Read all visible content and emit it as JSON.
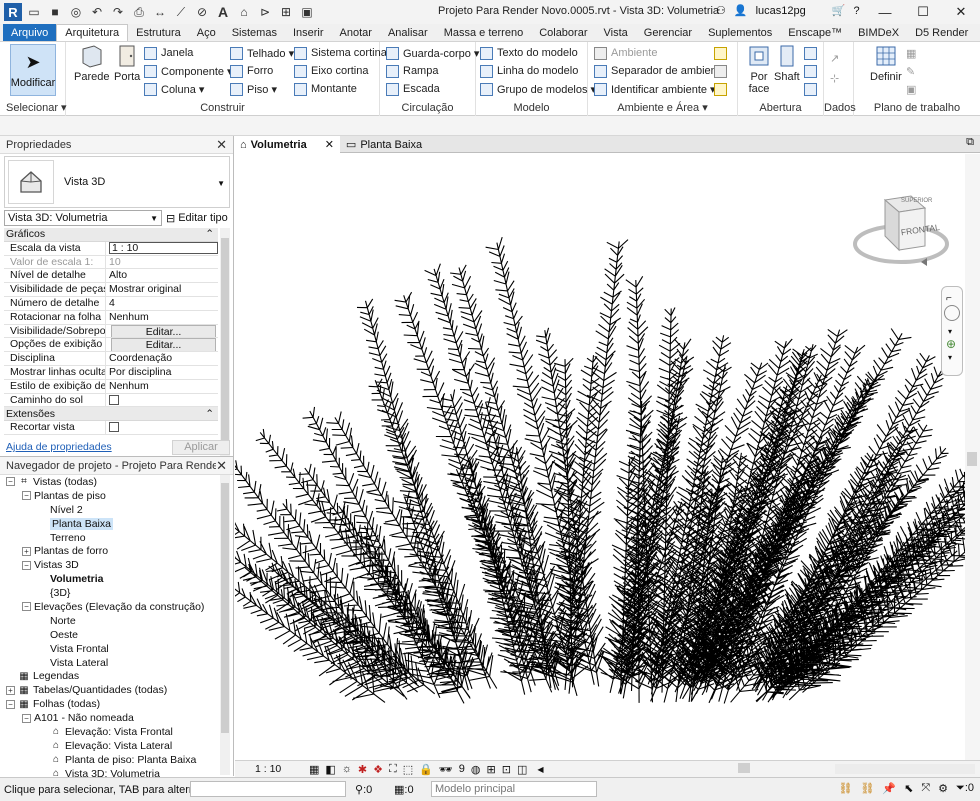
{
  "titlebar": {
    "doc_title": "Projeto Para Render Novo.0005.rvt - Vista 3D: Volumetria",
    "username": "lucas12pg",
    "app_logo_letter": "R",
    "text_tool": "A"
  },
  "tabs": [
    "Arquivo",
    "Arquitetura",
    "Estrutura",
    "Aço",
    "Sistemas",
    "Inserir",
    "Anotar",
    "Analisar",
    "Massa e terreno",
    "Colaborar",
    "Vista",
    "Gerenciar",
    "Suplementos",
    "Enscape™",
    "BIMDeX",
    "D5 Render"
  ],
  "ribbon": {
    "modify": "Modificar",
    "select": "Selecionar ▾",
    "construir": {
      "label": "Construir",
      "parede": "Parede",
      "porta": "Porta",
      "janela": "Janela",
      "componente": "Componente ▾",
      "coluna": "Coluna ▾",
      "telhado": "Telhado ▾",
      "forro": "Forro",
      "piso": "Piso ▾",
      "sistema_cortina": "Sistema cortina",
      "eixo_cortina": "Eixo cortina",
      "montante": "Montante"
    },
    "circulacao": {
      "label": "Circulação",
      "guarda_corpo": "Guarda-corpo ▾",
      "rampa": "Rampa",
      "escada": "Escada"
    },
    "modelo": {
      "label": "Modelo",
      "texto": "Texto do modelo",
      "linha": "Linha do modelo",
      "grupo": "Grupo de modelos ▾"
    },
    "ambiente": {
      "label": "Ambiente e Área ▾",
      "ambiente": "Ambiente",
      "separador": "Separador de ambiente",
      "identificar": "Identificar ambiente ▾"
    },
    "abertura": {
      "label": "Abertura",
      "por_face": "Por face",
      "shaft": "Shaft"
    },
    "dados": {
      "label": "Dados"
    },
    "plano": {
      "label": "Plano de trabalho",
      "definir": "Definir"
    }
  },
  "properties": {
    "title": "Propriedades",
    "type_name": "Vista 3D",
    "view_selector": "Vista 3D: Volumetria",
    "edit_type": "Editar tipo",
    "section_graficos": "Gráficos",
    "section_extensoes": "Extensões",
    "rows": [
      {
        "k": "Escala da vista",
        "v": "1 : 10"
      },
      {
        "k": "Valor de escala    1:",
        "v": "10"
      },
      {
        "k": "Nível de detalhe",
        "v": "Alto"
      },
      {
        "k": "Visibilidade de peças",
        "v": "Mostrar original"
      },
      {
        "k": "Número de detalhe",
        "v": "4"
      },
      {
        "k": "Rotacionar na folha",
        "v": "Nenhum"
      },
      {
        "k": "Visibilidade/Sobrepos...",
        "v": "Editar..."
      },
      {
        "k": "Opções de exibição d...",
        "v": "Editar..."
      },
      {
        "k": "Disciplina",
        "v": "Coordenação"
      },
      {
        "k": "Mostrar linhas ocultas",
        "v": "Por disciplina"
      },
      {
        "k": "Estilo de exibição de ...",
        "v": "Nenhum"
      },
      {
        "k": "Caminho do sol",
        "v": ""
      }
    ],
    "ext_rows": [
      {
        "k": "Recortar vista",
        "v": ""
      }
    ],
    "help_link": "Ajuda de propriedades",
    "apply": "Aplicar"
  },
  "browser": {
    "title": "Navegador de projeto - Projeto Para Render Novo...",
    "nodes": [
      {
        "lvl": 0,
        "t": "−",
        "icon": "views-icon",
        "label": "Vistas (todas)"
      },
      {
        "lvl": 1,
        "t": "−",
        "icon": "",
        "label": "Plantas de piso"
      },
      {
        "lvl": 2,
        "t": "",
        "icon": "",
        "label": "Nível 2"
      },
      {
        "lvl": 2,
        "t": "",
        "icon": "",
        "label": "Planta Baixa",
        "sel": true
      },
      {
        "lvl": 2,
        "t": "",
        "icon": "",
        "label": "Terreno"
      },
      {
        "lvl": 1,
        "t": "+",
        "icon": "",
        "label": "Plantas de forro"
      },
      {
        "lvl": 1,
        "t": "−",
        "icon": "",
        "label": "Vistas 3D"
      },
      {
        "lvl": 2,
        "t": "",
        "icon": "",
        "label": "Volumetria",
        "bold": true
      },
      {
        "lvl": 2,
        "t": "",
        "icon": "",
        "label": "{3D}"
      },
      {
        "lvl": 1,
        "t": "−",
        "icon": "",
        "label": "Elevações (Elevação da construção)"
      },
      {
        "lvl": 2,
        "t": "",
        "icon": "",
        "label": "Norte"
      },
      {
        "lvl": 2,
        "t": "",
        "icon": "",
        "label": "Oeste"
      },
      {
        "lvl": 2,
        "t": "",
        "icon": "",
        "label": "Vista Frontal"
      },
      {
        "lvl": 2,
        "t": "",
        "icon": "",
        "label": "Vista Lateral"
      },
      {
        "lvl": 0,
        "t": "",
        "icon": "legend-icon",
        "label": "Legendas"
      },
      {
        "lvl": 0,
        "t": "+",
        "icon": "schedule-icon",
        "label": "Tabelas/Quantidades (todas)"
      },
      {
        "lvl": 0,
        "t": "−",
        "icon": "sheet-icon",
        "label": "Folhas (todas)"
      },
      {
        "lvl": 1,
        "t": "−",
        "icon": "",
        "label": "A101 - Não nomeada"
      },
      {
        "lvl": 2,
        "t": "",
        "icon": "viewport-icon",
        "label": "Elevação: Vista Frontal"
      },
      {
        "lvl": 2,
        "t": "",
        "icon": "viewport-icon",
        "label": "Elevação: Vista Lateral"
      },
      {
        "lvl": 2,
        "t": "",
        "icon": "viewport-icon",
        "label": "Planta de piso: Planta Baixa"
      },
      {
        "lvl": 2,
        "t": "",
        "icon": "viewport-icon",
        "label": "Vista 3D: Volumetria"
      }
    ]
  },
  "view_tabs": [
    {
      "label": "Volumetria",
      "active": true
    },
    {
      "label": "Planta Baixa",
      "active": false
    }
  ],
  "viewcube": {
    "front": "FRONTAL",
    "top": "SUPERIOR"
  },
  "view_control": {
    "scale": "1 : 10",
    "detail_number": "9"
  },
  "status": {
    "message": "Clique para selecionar, TAB para alternat",
    "zero1": ":0",
    "zero2": ":0",
    "model": "Modelo principal",
    "filter": ":0"
  }
}
